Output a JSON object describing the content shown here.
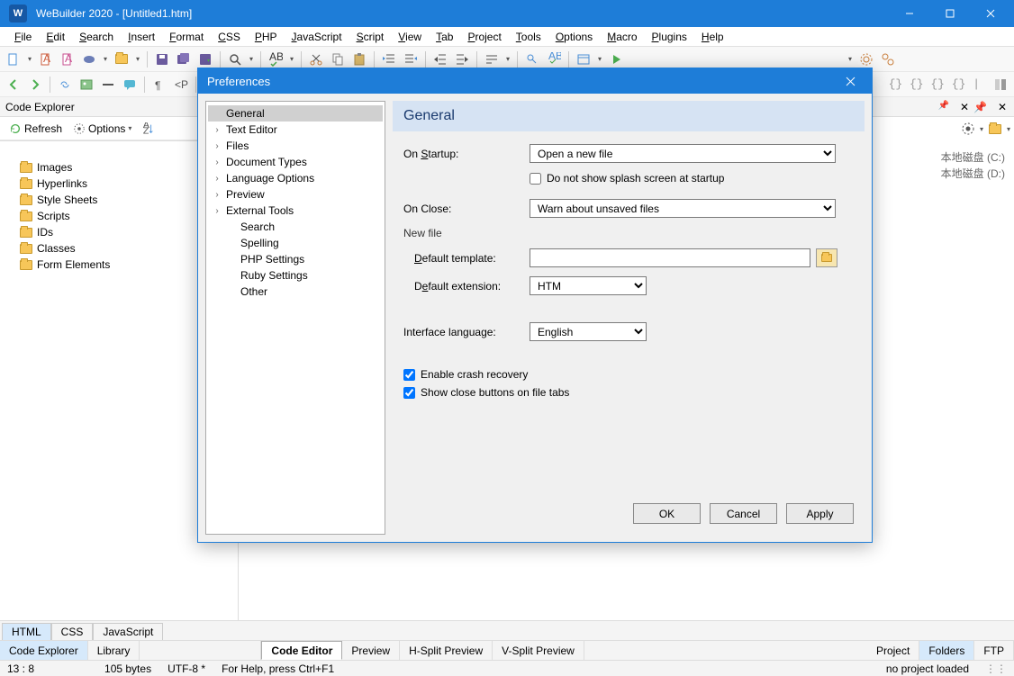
{
  "window": {
    "title": "WeBuilder 2020 - [Untitled1.htm]"
  },
  "menus": [
    "File",
    "Edit",
    "Search",
    "Insert",
    "Format",
    "CSS",
    "PHP",
    "JavaScript",
    "Script",
    "View",
    "Tab",
    "Project",
    "Tools",
    "Options",
    "Macro",
    "Plugins",
    "Help"
  ],
  "leftPanel": {
    "title": "Code Explorer",
    "refresh": "Refresh",
    "options": "Options",
    "items": [
      "Images",
      "Hyperlinks",
      "Style Sheets",
      "Scripts",
      "IDs",
      "Classes",
      "Form Elements"
    ]
  },
  "drives": {
    "c": "本地磁盘 (C:)",
    "d": "本地磁盘 (D:)"
  },
  "langTabs": [
    "HTML",
    "CSS",
    "JavaScript"
  ],
  "explorerTabs": [
    "Code Explorer",
    "Library"
  ],
  "editorTabs": [
    "Code Editor",
    "Preview",
    "H-Split Preview",
    "V-Split Preview"
  ],
  "rightTabs": [
    "Project",
    "Folders",
    "FTP"
  ],
  "status": {
    "pos": "13 : 8",
    "size": "105 bytes",
    "enc": "UTF-8 *",
    "help": "For Help, press Ctrl+F1",
    "project": "no project loaded"
  },
  "dialog": {
    "title": "Preferences",
    "nav": [
      {
        "label": "General",
        "sel": true,
        "expand": false
      },
      {
        "label": "Text Editor",
        "expand": true
      },
      {
        "label": "Files",
        "expand": true
      },
      {
        "label": "Document Types",
        "expand": true
      },
      {
        "label": "Language Options",
        "expand": true
      },
      {
        "label": "Preview",
        "expand": true
      },
      {
        "label": "External Tools",
        "expand": true
      },
      {
        "label": "Search",
        "indent": true
      },
      {
        "label": "Spelling",
        "indent": true
      },
      {
        "label": "PHP Settings",
        "indent": true
      },
      {
        "label": "Ruby Settings",
        "indent": true
      },
      {
        "label": "Other",
        "indent": true
      }
    ],
    "heading": "General",
    "labels": {
      "onStartup": "On Startup:",
      "onClose": "On Close:",
      "newFile": "New file",
      "defaultTemplate": "Default template:",
      "defaultExtension": "Default extension:",
      "interfaceLang": "Interface language:",
      "noSplash": "Do not show splash screen at startup",
      "crashRecovery": "Enable crash recovery",
      "closeBtns": "Show close buttons on file tabs"
    },
    "values": {
      "onStartup": "Open a new file",
      "onClose": "Warn about unsaved files",
      "defaultTemplate": "",
      "defaultExtension": "HTM",
      "interfaceLang": "English"
    },
    "buttons": {
      "ok": "OK",
      "cancel": "Cancel",
      "apply": "Apply"
    }
  }
}
